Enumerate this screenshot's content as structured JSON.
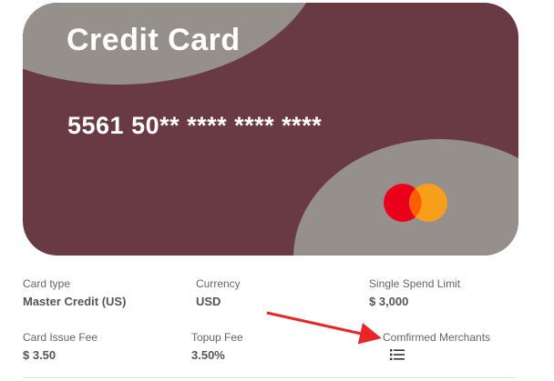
{
  "card": {
    "title": "Credit Card",
    "number": "5561 50** **** **** ****",
    "brand_icon": "mastercard-logo",
    "colors": {
      "background": "#6a3a44",
      "accent_shape": "#95908c",
      "mc_red": "#eb001b",
      "mc_orange": "#f79e1b"
    }
  },
  "details": {
    "card_type": {
      "label": "Card type",
      "value": "Master Credit (US)"
    },
    "currency": {
      "label": "Currency",
      "value": "USD"
    },
    "single_spend_limit": {
      "label": "Single Spend Limit",
      "value": "$ 3,000"
    },
    "card_issue_fee": {
      "label": "Card Issue Fee",
      "value": "$ 3.50"
    },
    "topup_fee": {
      "label": "Topup Fee",
      "value": "3.50%"
    },
    "confirmed_merchants": {
      "label": "Comfirmed Merchants",
      "icon": "list-icon"
    }
  },
  "annotation": {
    "arrow_color": "#e8262a"
  }
}
